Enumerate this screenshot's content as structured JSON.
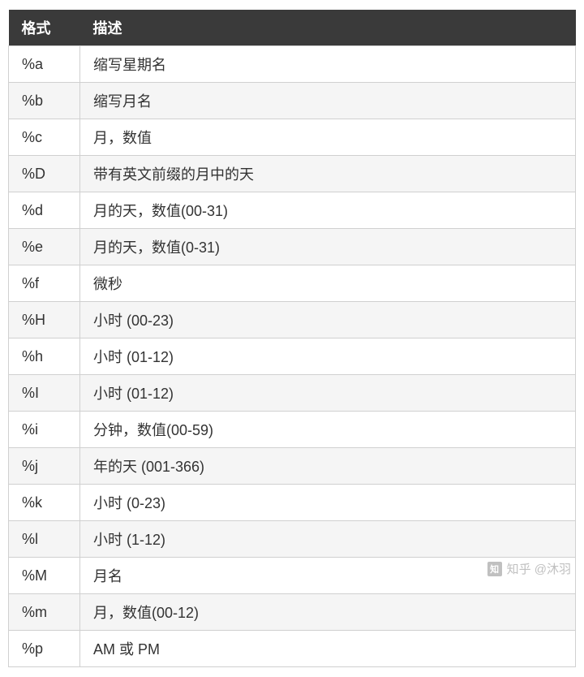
{
  "table": {
    "headers": [
      "格式",
      "描述"
    ],
    "rows": [
      {
        "format": "%a",
        "desc": "缩写星期名"
      },
      {
        "format": "%b",
        "desc": "缩写月名"
      },
      {
        "format": "%c",
        "desc": "月，数值"
      },
      {
        "format": "%D",
        "desc": "带有英文前缀的月中的天"
      },
      {
        "format": "%d",
        "desc": "月的天，数值(00-31)"
      },
      {
        "format": "%e",
        "desc": "月的天，数值(0-31)"
      },
      {
        "format": "%f",
        "desc": "微秒"
      },
      {
        "format": "%H",
        "desc": "小时 (00-23)"
      },
      {
        "format": "%h",
        "desc": "小时 (01-12)"
      },
      {
        "format": "%I",
        "desc": "小时 (01-12)"
      },
      {
        "format": "%i",
        "desc": "分钟，数值(00-59)"
      },
      {
        "format": "%j",
        "desc": "年的天 (001-366)"
      },
      {
        "format": "%k",
        "desc": "小时 (0-23)"
      },
      {
        "format": "%l",
        "desc": "小时 (1-12)"
      },
      {
        "format": "%M",
        "desc": "月名"
      },
      {
        "format": "%m",
        "desc": "月，数值(00-12)"
      },
      {
        "format": "%p",
        "desc": "AM 或 PM"
      }
    ]
  },
  "watermark": {
    "icon": "知",
    "text": "知乎 @沐羽"
  }
}
